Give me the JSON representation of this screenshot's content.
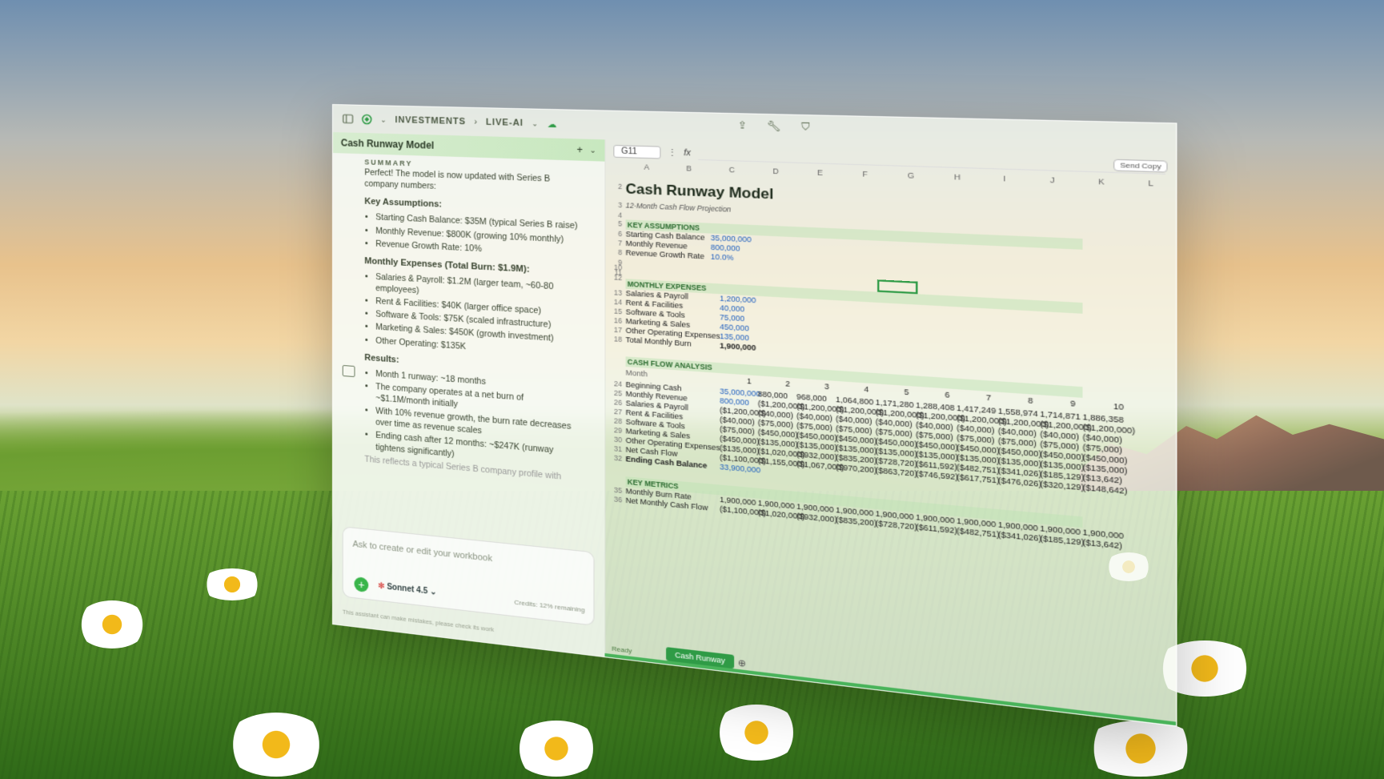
{
  "app": {
    "breadcrumb_root": "INVESTMENTS",
    "breadcrumb_sep": "›",
    "breadcrumb_leaf": "LIVE-AI",
    "accent": "#2f9b46"
  },
  "chat": {
    "tab_title": "Cash Runway Model",
    "summary_label": "SUMMARY",
    "intro": "Perfect! The model is now updated with Series B company numbers:",
    "key_assumptions_title": "Key Assumptions:",
    "key_assumptions": [
      "Starting Cash Balance: $35M (typical Series B raise)",
      "Monthly Revenue: $800K (growing 10% monthly)",
      "Revenue Growth Rate: 10%"
    ],
    "expenses_title": "Monthly Expenses (Total Burn: $1.9M):",
    "expenses": [
      "Salaries & Payroll: $1.2M (larger team, ~60-80 employees)",
      "Rent & Facilities: $40K (larger office space)",
      "Software & Tools: $75K (scaled infrastructure)",
      "Marketing & Sales: $450K (growth investment)",
      "Other Operating: $135K"
    ],
    "results_title": "Results:",
    "results": [
      "Month 1 runway: ~18 months",
      "The company operates at a net burn of ~$1.1M/month initially",
      "With 10% revenue growth, the burn rate decreases over time as revenue scales",
      "Ending cash after 12 months: ~$247K (runway tightens significantly)"
    ],
    "truncated": "This reflects a typical Series B company profile with",
    "input_placeholder": "Ask to create or edit your workbook",
    "model_name": "Sonnet 4.5",
    "disclaimer": "This assistant can make mistakes, please check its work",
    "credits": "Credits: 12% remaining"
  },
  "sheet": {
    "cell_ref": "G11",
    "fx": "fx",
    "send_copy": "Send Copy",
    "columns": [
      "A",
      "B",
      "C",
      "D",
      "E",
      "F",
      "G",
      "H",
      "I",
      "J",
      "K",
      "L"
    ],
    "title": "Cash Runway Model",
    "subtitle": "12-Month Cash Flow Projection",
    "key_assumptions": "KEY ASSUMPTIONS",
    "assumptions": [
      {
        "label": "Starting Cash Balance",
        "value": "35,000,000"
      },
      {
        "label": "Monthly Revenue",
        "value": "800,000"
      },
      {
        "label": "Revenue Growth Rate",
        "value": "10.0%"
      }
    ],
    "monthly_expenses": "MONTHLY EXPENSES",
    "expenses": [
      {
        "label": "Salaries & Payroll",
        "value": "1,200,000"
      },
      {
        "label": "Rent & Facilities",
        "value": "40,000"
      },
      {
        "label": "Software & Tools",
        "value": "75,000"
      },
      {
        "label": "Marketing & Sales",
        "value": "450,000"
      },
      {
        "label": "Other Operating Expenses",
        "value": "135,000"
      },
      {
        "label": "Total Monthly Burn",
        "value": "1,900,000"
      }
    ],
    "cash_flow": "CASH FLOW ANALYSIS",
    "month_label": "Month",
    "months": [
      "1",
      "2",
      "3",
      "4",
      "5",
      "6",
      "7",
      "8",
      "9",
      "10"
    ],
    "flow_rows": [
      {
        "label": "Beginning Cash",
        "values": [
          "35,000,000",
          "880,000",
          "968,000",
          "1,064,800",
          "1,171,280",
          "1,288,408",
          "1,417,249",
          "1,558,974",
          "1,714,871",
          "1,886,358"
        ]
      },
      {
        "label": "Monthly Revenue",
        "values": [
          "800,000",
          "($1,200,000)",
          "($1,200,000)",
          "($1,200,000)",
          "($1,200,000)",
          "($1,200,000)",
          "($1,200,000)",
          "($1,200,000)",
          "($1,200,000)",
          "($1,200,000)"
        ]
      },
      {
        "label": "Salaries & Payroll",
        "values": [
          "($1,200,000)",
          "($40,000)",
          "($40,000)",
          "($40,000)",
          "($40,000)",
          "($40,000)",
          "($40,000)",
          "($40,000)",
          "($40,000)",
          "($40,000)"
        ]
      },
      {
        "label": "Rent & Facilities",
        "values": [
          "($40,000)",
          "($75,000)",
          "($75,000)",
          "($75,000)",
          "($75,000)",
          "($75,000)",
          "($75,000)",
          "($75,000)",
          "($75,000)",
          "($75,000)"
        ]
      },
      {
        "label": "Software & Tools",
        "values": [
          "($75,000)",
          "($450,000)",
          "($450,000)",
          "($450,000)",
          "($450,000)",
          "($450,000)",
          "($450,000)",
          "($450,000)",
          "($450,000)",
          "($450,000)"
        ]
      },
      {
        "label": "Marketing & Sales",
        "values": [
          "($450,000)",
          "($135,000)",
          "($135,000)",
          "($135,000)",
          "($135,000)",
          "($135,000)",
          "($135,000)",
          "($135,000)",
          "($135,000)",
          "($135,000)"
        ]
      },
      {
        "label": "Other Operating Expenses",
        "values": [
          "($135,000)",
          "($1,020,000)",
          "($932,000)",
          "($835,200)",
          "($728,720)",
          "($611,592)",
          "($482,751)",
          "($341,026)",
          "($185,129)",
          "($13,642)"
        ]
      },
      {
        "label": "Net Cash Flow",
        "values": [
          "($1,100,000)",
          "($1,155,000)",
          "($1,067,000)",
          "($970,200)",
          "($863,720)",
          "($746,592)",
          "($617,751)",
          "($476,026)",
          "($320,129)",
          "($148,642)"
        ]
      },
      {
        "label": "Ending Cash Balance",
        "values": [
          "33,900,000",
          "",
          "",
          "",
          "",
          "",
          "",
          "",
          "",
          ""
        ]
      }
    ],
    "key_metrics": "KEY METRICS",
    "metrics": [
      {
        "label": "Monthly Burn Rate",
        "values": [
          "1,900,000",
          "1,900,000",
          "1,900,000",
          "1,900,000",
          "1,900,000",
          "1,900,000",
          "1,900,000",
          "1,900,000",
          "1,900,000",
          "1,900,000"
        ]
      },
      {
        "label": "Net Monthly Cash Flow",
        "values": [
          "($1,100,000)",
          "($1,020,000)",
          "($932,000)",
          "($835,200)",
          "($728,720)",
          "($611,592)",
          "($482,751)",
          "($341,026)",
          "($185,129)",
          "($13,642)"
        ]
      }
    ],
    "sheet_tab": "Cash Runway",
    "status": "Ready"
  }
}
